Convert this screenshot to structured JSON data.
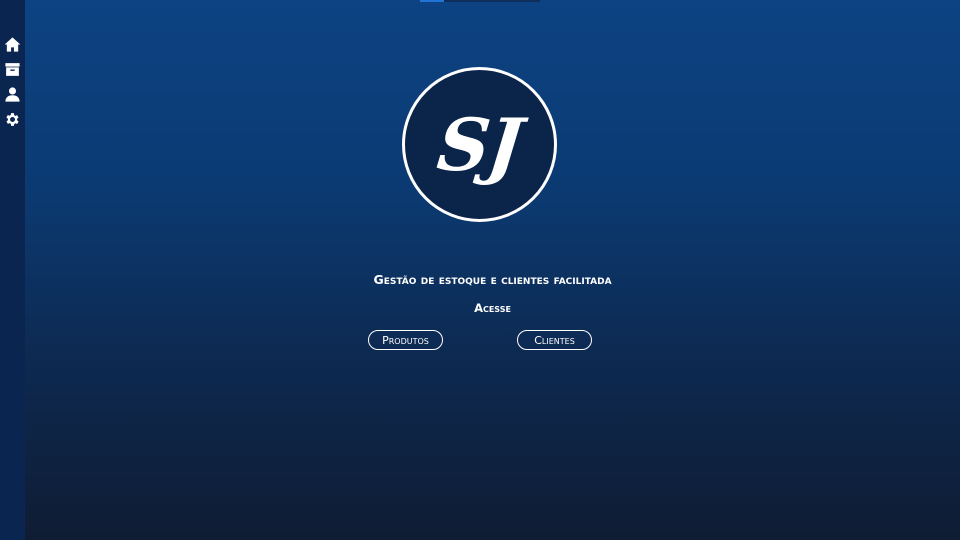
{
  "sidebar": {
    "items": [
      {
        "icon": "home-icon",
        "label": "Home"
      },
      {
        "icon": "archive-icon",
        "label": "Estoque"
      },
      {
        "icon": "user-icon",
        "label": "Clientes"
      },
      {
        "icon": "gear-icon",
        "label": "Configurações"
      }
    ]
  },
  "logo": {
    "text": "SJ"
  },
  "hero": {
    "tagline": "Gestão de estoque e clientes facilitada",
    "access_label": "Acesse"
  },
  "buttons": {
    "produtos": "Produtos",
    "clientes": "Clientes"
  },
  "colors": {
    "accent": "#1f74d6",
    "sidebar": "#0b2551",
    "logo_bg": "#0b244a",
    "gradient_top": "#0d4383",
    "gradient_bottom": "#0f1c33"
  }
}
